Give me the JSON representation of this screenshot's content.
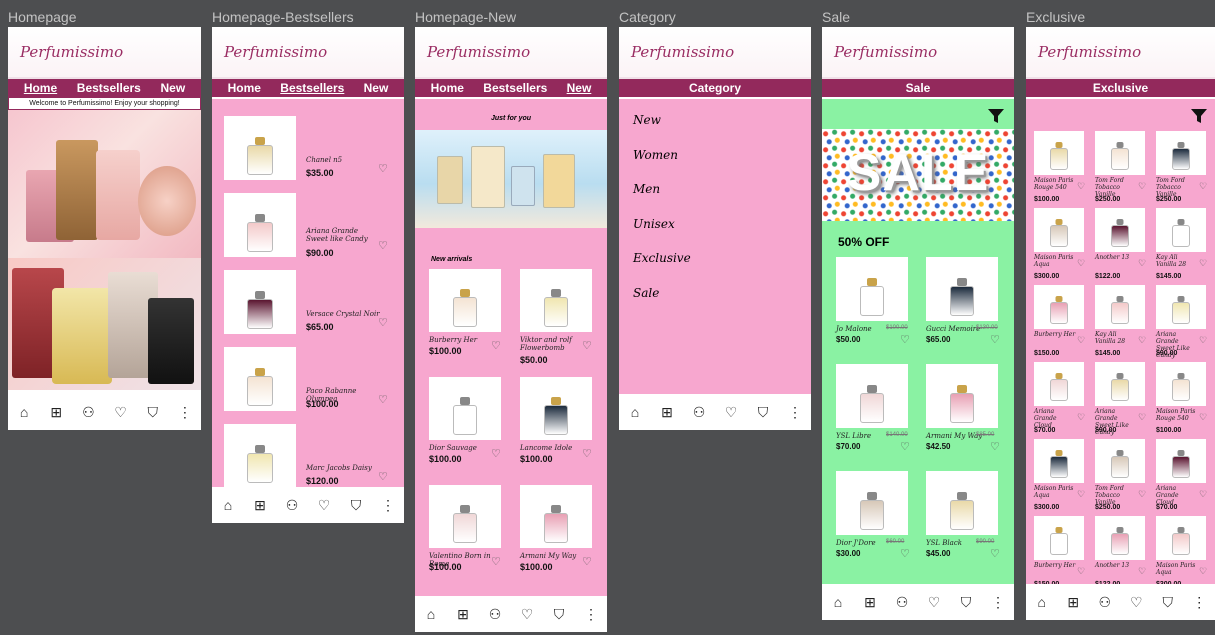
{
  "brand": "Perfumissimo",
  "screens": {
    "homepage": {
      "label": "Homepage",
      "welcome": "Welcome to Perfumissimo! Enjoy your shopping!"
    },
    "bestsellers": {
      "label": "Homepage-Bestsellers"
    },
    "new": {
      "label": "Homepage-New",
      "just_for_you": "Just for you",
      "new_arrivals": "New arrivals"
    },
    "category": {
      "label": "Category",
      "title": "Category",
      "items": [
        "New",
        "Women",
        "Men",
        "Unisex",
        "Exclusive",
        "Sale"
      ]
    },
    "sale": {
      "label": "Sale",
      "title": "Sale",
      "banner": "SALE",
      "discount": "50% OFF"
    },
    "exclusive": {
      "label": "Exclusive",
      "title": "Exclusive"
    }
  },
  "nav": {
    "home": "Home",
    "bestsellers": "Bestsellers",
    "new": "New"
  },
  "bottom_nav_icons": [
    "home-icon",
    "grid-icon",
    "user-icon",
    "heart-icon",
    "bag-icon",
    "more-icon"
  ],
  "bottom_nav_glyphs": [
    "⌂",
    "⊞",
    "⚇",
    "♡",
    "⛉",
    "⋮"
  ],
  "bestsellers_products": [
    {
      "name": "Chanel n5",
      "price": "$35.00"
    },
    {
      "name": "Ariana Grande Sweet like Candy",
      "price": "$90.00"
    },
    {
      "name": "Versace Crystal Noir",
      "price": "$65.00"
    },
    {
      "name": "Paco Rabanne Olympea",
      "price": "$100.00"
    },
    {
      "name": "Marc Jacobs Daisy",
      "price": "$120.00"
    }
  ],
  "new_products": [
    {
      "name": "Burberry Her",
      "price": "$100.00"
    },
    {
      "name": "Viktor and rolf Flowerbomb",
      "price": "$50.00"
    },
    {
      "name": "Dior Sauvage",
      "price": "$100.00"
    },
    {
      "name": "Lancome Idole",
      "price": "$100.00"
    },
    {
      "name": "Valentino Born in Roma",
      "price": "$100.00"
    },
    {
      "name": "Armani My Way",
      "price": "$100.00"
    }
  ],
  "sale_products": [
    {
      "name": "Jo Malone",
      "old_price": "$100.00",
      "price": "$50.00"
    },
    {
      "name": "Gucci Memoire",
      "old_price": "$130.00",
      "price": "$65.00"
    },
    {
      "name": "YSL Libre",
      "old_price": "$140.00",
      "price": "$70.00"
    },
    {
      "name": "Armani My Way",
      "old_price": "$85.00",
      "price": "$42.50"
    },
    {
      "name": "Dior J'Dore",
      "old_price": "$60.00",
      "price": "$30.00"
    },
    {
      "name": "YSL Black",
      "old_price": "$90.00",
      "price": "$45.00"
    }
  ],
  "exclusive_products": [
    {
      "name": "Maison Paris Rouge 540",
      "price": "$100.00"
    },
    {
      "name": "Tom Ford Tobacco Vanille",
      "price": "$250.00"
    },
    {
      "name": "Tom Ford Tobacco Vanille",
      "price": "$250.00"
    },
    {
      "name": "Maison Paris Aqua",
      "price": "$300.00"
    },
    {
      "name": "Another 13",
      "price": "$122.00"
    },
    {
      "name": "Kay Ali Vanilla 28",
      "price": "$145.00"
    },
    {
      "name": "Burberry Her",
      "price": "$150.00"
    },
    {
      "name": "Kay Ali Vanilla 28",
      "price": "$145.00"
    },
    {
      "name": "Ariana Grande Sweet Like Candy",
      "price": "$90.00"
    },
    {
      "name": "Ariana Grande Cloud",
      "price": "$70.00"
    },
    {
      "name": "Ariana Grande Sweet Like Candy",
      "price": "$90.00"
    },
    {
      "name": "Maison Paris Rouge 540",
      "price": "$100.00"
    },
    {
      "name": "Maison Paris Aqua",
      "price": "$300.00"
    },
    {
      "name": "Tom Ford Tobacco Vanille",
      "price": "$250.00"
    },
    {
      "name": "Ariana Grande Cloud",
      "price": "$70.00"
    },
    {
      "name": "Burberry Her",
      "price": "$150.00"
    },
    {
      "name": "Another 13",
      "price": "$122.00"
    },
    {
      "name": "Maison Paris Aqua",
      "price": "$300.00"
    }
  ],
  "colors": {
    "accent": "#93295c",
    "pink": "#f7a7cf",
    "green": "#8af2a3",
    "brand": "#9a2d63",
    "canvas": "#4d4e50"
  }
}
